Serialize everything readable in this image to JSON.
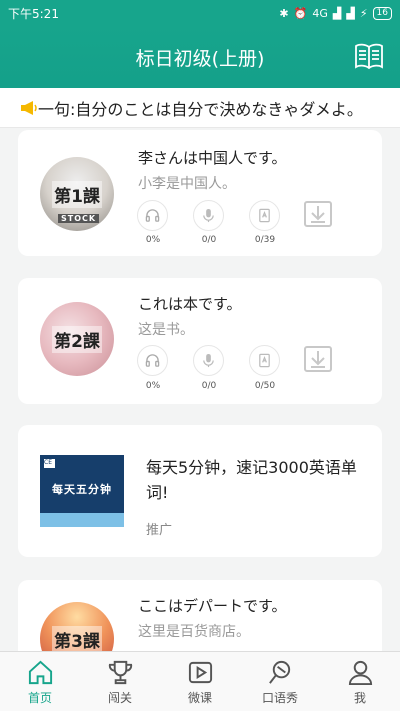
{
  "status": {
    "time": "下午5:21",
    "signal": "4G",
    "battery": "16"
  },
  "appbar": {
    "title": "标日初级(上册)"
  },
  "ticker": {
    "text": "一句:自分のことは自分で決めなきゃダメよ。"
  },
  "lessons": [
    {
      "badge": "第1課",
      "japanese": "李さんは中国人です。",
      "chinese": "小李是中国人。",
      "listen": "0%",
      "record": "0/0",
      "words": "0/39"
    },
    {
      "badge": "第2課",
      "japanese": "これは本です。",
      "chinese": "这是书。",
      "listen": "0%",
      "record": "0/0",
      "words": "0/50"
    },
    {
      "badge": "第3課",
      "japanese": "ここはデパートです。",
      "chinese": "这里是百货商店。"
    }
  ],
  "lesson1_cover_text": "STOCK",
  "ad": {
    "image_text": "每天五分钟",
    "text": "每天5分钟，速记3000英语单词!",
    "tag": "推广"
  },
  "tabs": [
    {
      "label": "首页",
      "icon": "home-icon",
      "active": true
    },
    {
      "label": "闯关",
      "icon": "trophy-icon"
    },
    {
      "label": "微课",
      "icon": "play-icon"
    },
    {
      "label": "口语秀",
      "icon": "search-icon"
    },
    {
      "label": "我",
      "icon": "person-icon"
    }
  ],
  "colors": {
    "accent": "#17a58c"
  }
}
